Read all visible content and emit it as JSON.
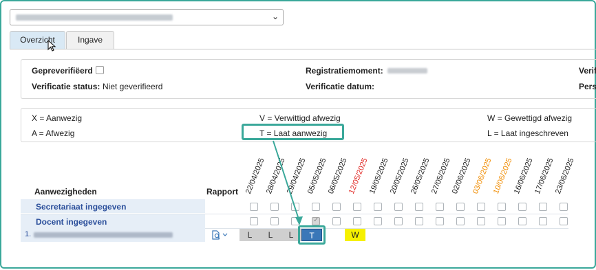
{
  "tabs": [
    "Overzicht",
    "Ingave"
  ],
  "info": {
    "pre_verified_label": "Gepreverifiëerd",
    "verification_status_label": "Verificatie status:",
    "verification_status_value": "Niet geverifieerd",
    "registration_moment_label": "Registratiemoment:",
    "verification_date_label": "Verificatie datum:",
    "right_label_1": "Verif",
    "right_label_2": "Pers"
  },
  "legend": [
    "X = Aanwezig",
    "V = Verwittigd afwezig",
    "W = Gewettigd afwezig",
    "A = Afwezig",
    "T = Laat aanwezig",
    "L = Laat ingeschreven"
  ],
  "grid": {
    "col_attendance": "Aanwezigheden",
    "col_report": "Rapport",
    "row_secretariat": "Secretariaat ingegeven",
    "row_teacher": "Docent ingegeven",
    "student_number": "1.",
    "dates": [
      {
        "d": "22/04/2025",
        "color": "#222222"
      },
      {
        "d": "28/04/2025",
        "color": "#222222"
      },
      {
        "d": "29/04/2025",
        "color": "#222222"
      },
      {
        "d": "05/05/2025",
        "color": "#222222"
      },
      {
        "d": "06/05/2025",
        "color": "#222222"
      },
      {
        "d": "12/05/2025",
        "color": "#e0231f"
      },
      {
        "d": "19/05/2025",
        "color": "#222222"
      },
      {
        "d": "20/05/2025",
        "color": "#222222"
      },
      {
        "d": "26/05/2025",
        "color": "#222222"
      },
      {
        "d": "27/05/2025",
        "color": "#222222"
      },
      {
        "d": "02/06/2025",
        "color": "#222222"
      },
      {
        "d": "03/06/2025",
        "color": "#f08c00"
      },
      {
        "d": "10/06/2025",
        "color": "#f08c00"
      },
      {
        "d": "16/06/2025",
        "color": "#222222"
      },
      {
        "d": "17/06/2025",
        "color": "#222222"
      },
      {
        "d": "23/06/2025",
        "color": "#222222"
      }
    ],
    "teacher_checked_index": 3,
    "student_cells": [
      {
        "index": 0,
        "code": "L"
      },
      {
        "index": 1,
        "code": "L"
      },
      {
        "index": 2,
        "code": "L"
      },
      {
        "index": 3,
        "code": "T"
      },
      {
        "index": 5,
        "code": "W"
      }
    ]
  },
  "icons": {
    "selector": "chevron-down-icon",
    "report": "document-search-icon",
    "cursor": "mouse-pointer-icon"
  },
  "colors": {
    "highlight": "#3aa89a",
    "late_present": "#3a77b8",
    "justified_absent": "#f6f000",
    "late_registered": "#cfcfcf"
  }
}
